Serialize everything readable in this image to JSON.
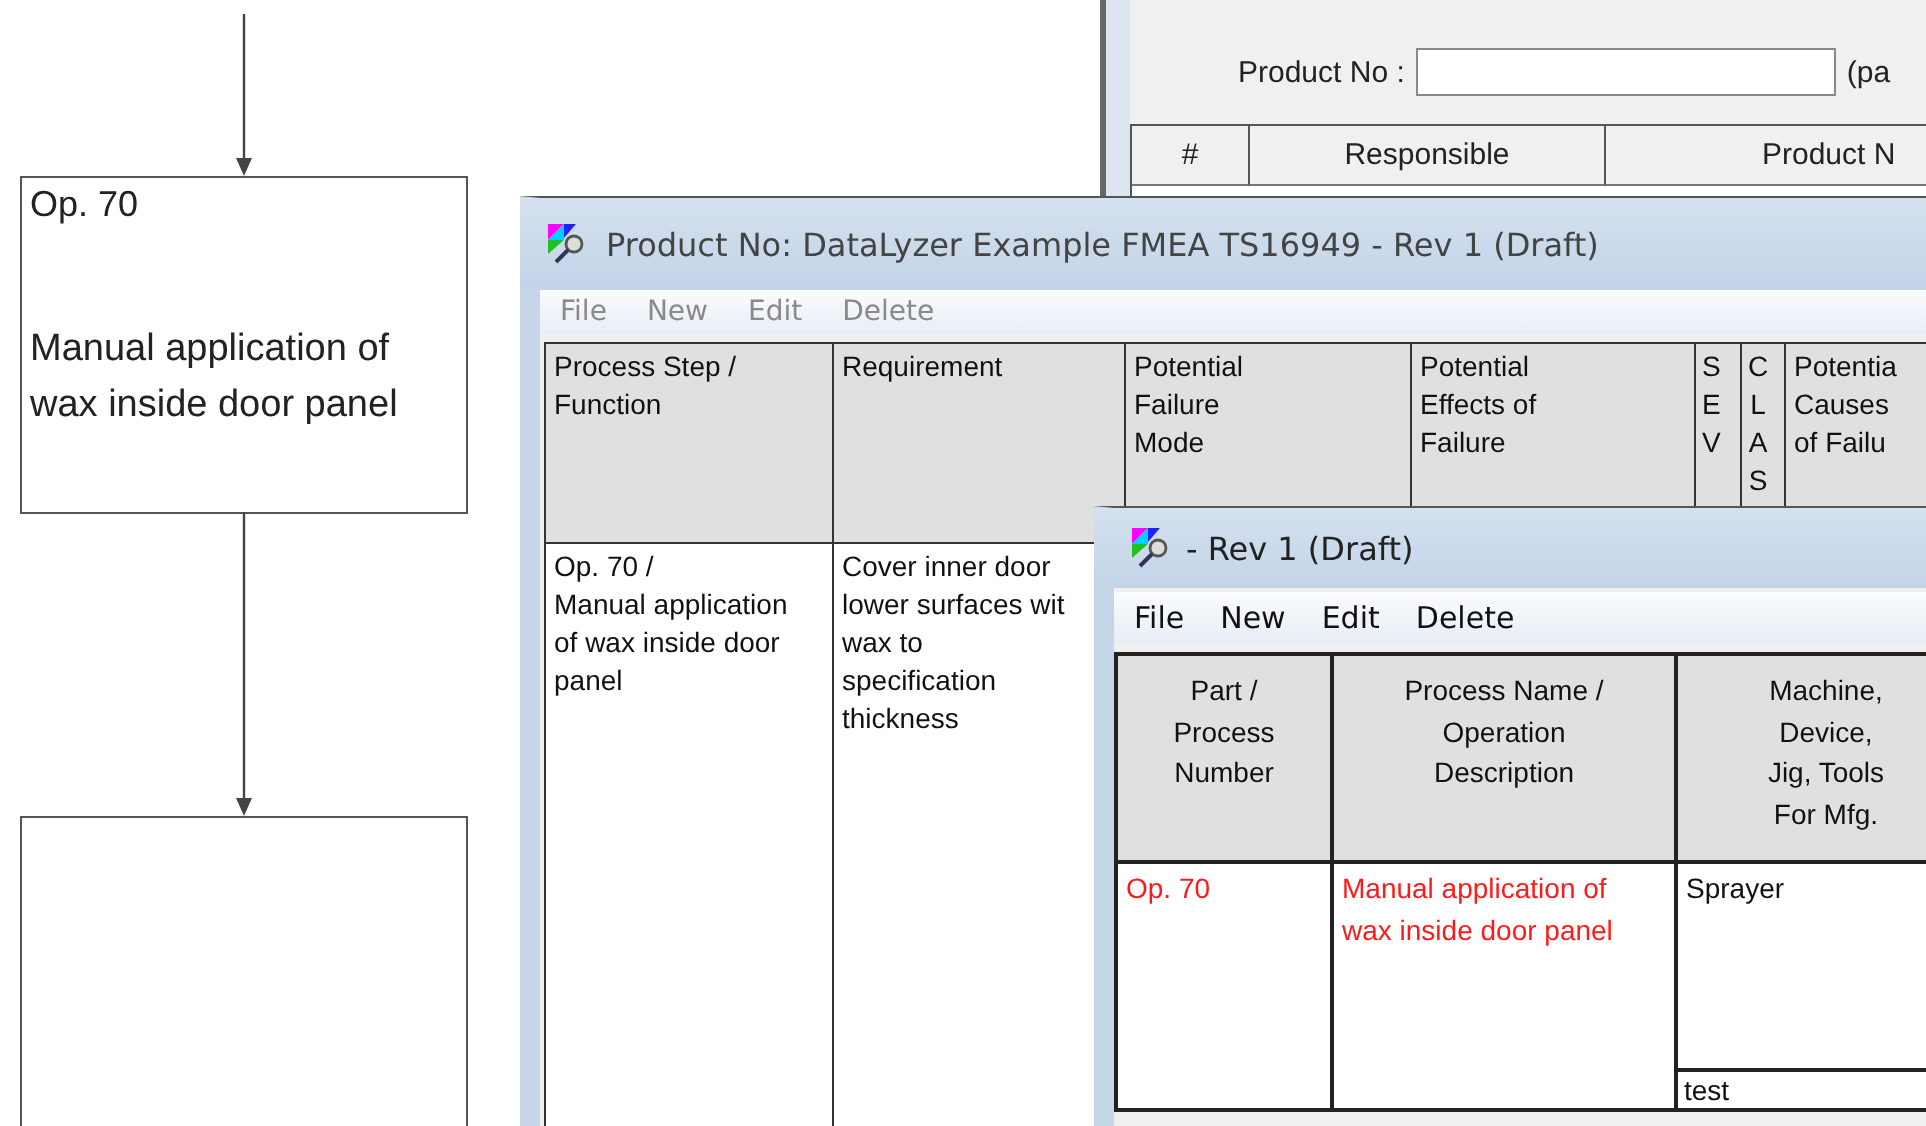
{
  "flowchart": {
    "nodes": [
      {
        "kind": "process",
        "number": "Op. 70",
        "text": "Manual application of\nwax inside door panel"
      },
      {
        "kind": "blank"
      }
    ]
  },
  "back_window": {
    "product_no_label": "Product No :",
    "product_no_hint": "(pa",
    "table": {
      "columns": [
        "#",
        "Responsible",
        "Product N"
      ]
    }
  },
  "fmea_window": {
    "title": "Product No: DataLyzer Example FMEA TS16949 - Rev 1 (Draft)",
    "menu": [
      {
        "label": "File",
        "disabled": true
      },
      {
        "label": "New",
        "disabled": true
      },
      {
        "label": "Edit",
        "disabled": true
      },
      {
        "label": "Delete",
        "disabled": true
      }
    ],
    "table": {
      "columns": [
        "Process Step /\nFunction",
        "Requirement",
        "Potential\nFailure\nMode",
        "Potential\nEffects of\nFailure",
        "S\nE\nV",
        "C\nL\nA\nS",
        "Potentia\nCauses\nof Failu"
      ],
      "rows": [
        {
          "cells": [
            "Op. 70 /\nManual application\nof wax inside door\npanel",
            "Cover inner door\nlower surfaces wit\nwax to\nspecification\nthickness"
          ]
        }
      ]
    }
  },
  "control_plan_window": {
    "title": "- Rev 1 (Draft)",
    "menu": [
      {
        "label": "File",
        "disabled": false
      },
      {
        "label": "New",
        "disabled": false
      },
      {
        "label": "Edit",
        "disabled": false
      },
      {
        "label": "Delete",
        "disabled": false
      }
    ],
    "table": {
      "columns": [
        "Part /\nProcess\nNumber",
        "Process Name /\nOperation\nDescription",
        "Machine,\nDevice,\nJig, Tools\nFor Mfg."
      ],
      "rows": [
        {
          "cells": [
            {
              "text": "Op. 70",
              "flagged": true
            },
            {
              "text": "Manual application of\nwax inside door panel",
              "flagged": true
            },
            {
              "text": "Sprayer",
              "flagged": false,
              "sub_value": "test"
            }
          ]
        }
      ]
    }
  }
}
